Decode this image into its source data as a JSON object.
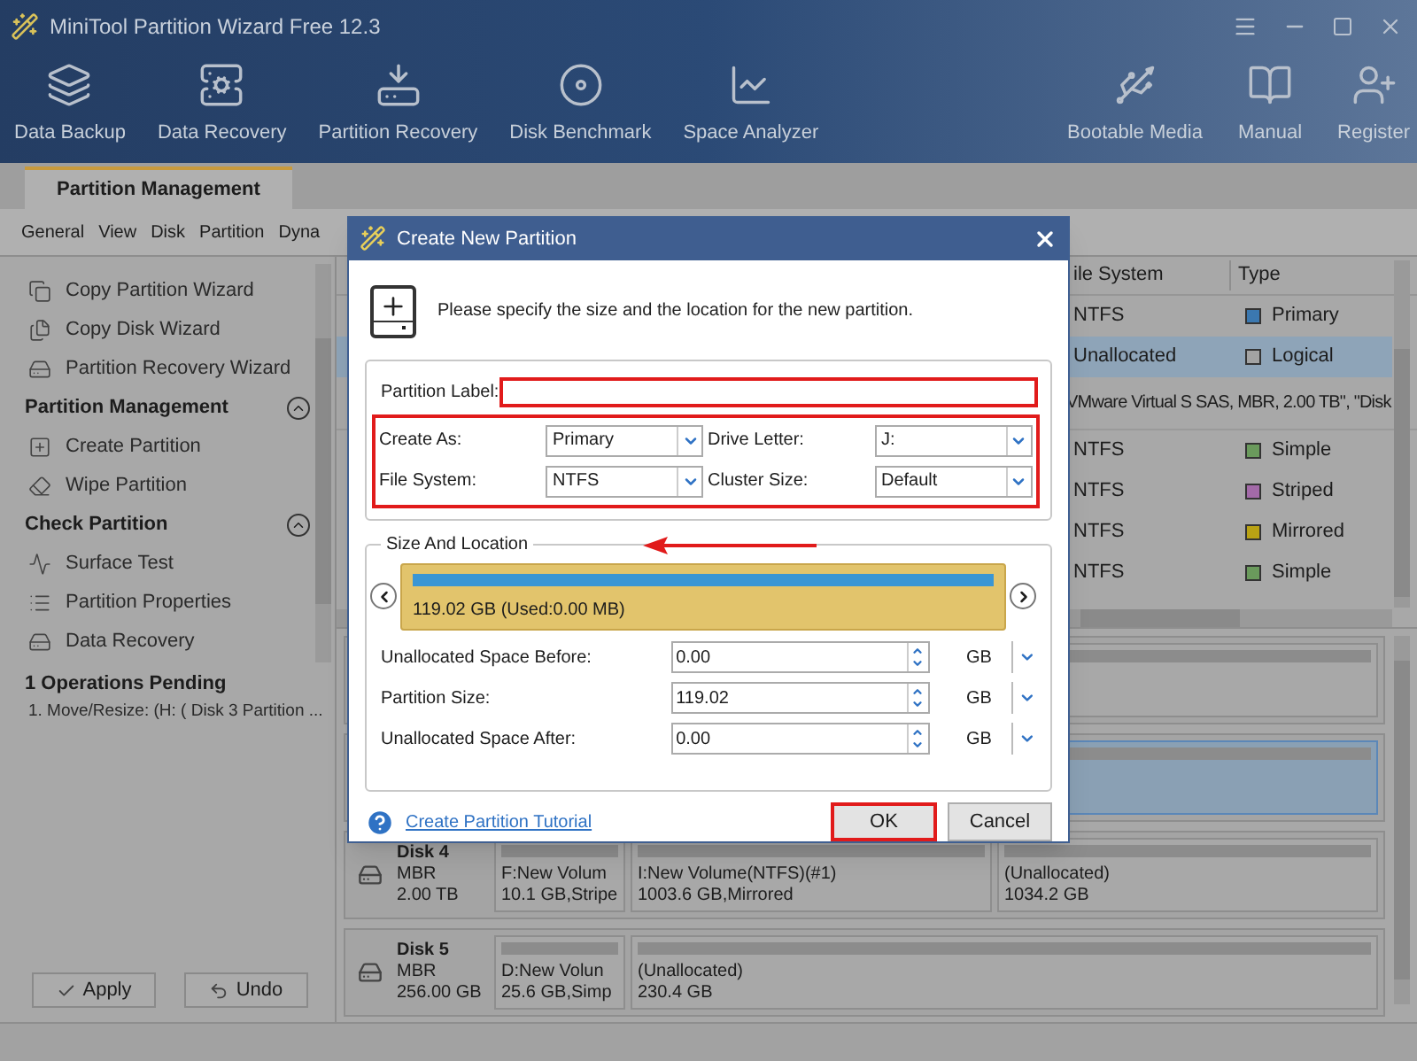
{
  "window": {
    "title": "MiniTool Partition Wizard Free 12.3"
  },
  "toolbar": [
    {
      "label": "Data Backup"
    },
    {
      "label": "Data Recovery"
    },
    {
      "label": "Partition Recovery"
    },
    {
      "label": "Disk Benchmark"
    },
    {
      "label": "Space Analyzer"
    }
  ],
  "toolbar_right": [
    {
      "label": "Bootable Media"
    },
    {
      "label": "Manual"
    },
    {
      "label": "Register"
    }
  ],
  "tabs": [
    {
      "label": "Partition Management",
      "selected": true
    }
  ],
  "menu": [
    "General",
    "View",
    "Disk",
    "Partition",
    "Dyna"
  ],
  "sidebar": {
    "sections": [
      {
        "items": [
          "Copy Partition Wizard",
          "Copy Disk Wizard",
          "Partition Recovery Wizard"
        ]
      },
      {
        "title": "Partition Management",
        "expanded": true,
        "items": [
          "Create Partition",
          "Wipe Partition"
        ]
      },
      {
        "title": "Check Partition",
        "expanded": true,
        "items": [
          "Surface Test",
          "Partition Properties",
          "Data Recovery"
        ]
      }
    ],
    "pending": {
      "title": "1 Operations Pending",
      "items": [
        "1. Move/Resize: (H: ( Disk 3 Partition ..."
      ]
    },
    "buttons": [
      "Apply",
      "Undo"
    ]
  },
  "table": {
    "columns": [
      "ile System",
      "Type"
    ],
    "rows": [
      {
        "kind": "partition",
        "file_system": "NTFS",
        "type": "Primary",
        "color": "#3b78b0",
        "selected": false
      },
      {
        "kind": "partition",
        "file_system": "Unallocated",
        "type": "Logical",
        "color": "#a3a3a3",
        "selected": true
      },
      {
        "kind": "disk",
        "text": "VMware Virtual S SAS, MBR, 2.00 TB\", \"Disk"
      },
      {
        "kind": "partition",
        "file_system": "NTFS",
        "type": "Simple",
        "color": "#6a9a5c",
        "selected": false
      },
      {
        "kind": "partition",
        "file_system": "NTFS",
        "type": "Striped",
        "color": "#a36aa8",
        "selected": false
      },
      {
        "kind": "partition",
        "file_system": "NTFS",
        "type": "Mirrored",
        "color": "#b9a214",
        "selected": false
      },
      {
        "kind": "partition",
        "file_system": "NTFS",
        "type": "Simple",
        "color": "#6a9a5c",
        "selected": false
      }
    ]
  },
  "disk_map": [
    {
      "partitions": [
        {
          "selected": false
        }
      ]
    },
    {
      "partitions": [
        {
          "selected": true
        }
      ]
    },
    {
      "name": "Disk 4",
      "lines": [
        "MBR",
        "2.00 TB"
      ],
      "partitions": [
        {
          "lines": [
            "F:New Volum",
            "10.1 GB,Stripe"
          ],
          "selected": false
        },
        {
          "lines": [
            "I:New Volume(NTFS)(#1)",
            "1003.6 GB,Mirrored"
          ],
          "selected": false
        },
        {
          "lines": [
            "(Unallocated)",
            "1034.2 GB"
          ],
          "selected": false
        }
      ]
    },
    {
      "name": "Disk 5",
      "lines": [
        "MBR",
        "256.00 GB"
      ],
      "partitions": [
        {
          "lines": [
            "D:New Volun",
            "25.6 GB,Simp"
          ],
          "selected": false
        },
        {
          "lines": [
            "(Unallocated)",
            "230.4 GB"
          ],
          "selected": false
        }
      ]
    }
  ],
  "dialog": {
    "title": "Create New Partition",
    "message": "Please specify the size and the location for the new partition.",
    "label_field": {
      "label": "Partition Label:",
      "highlighted": true
    },
    "selects_highlighted": true,
    "selects": [
      {
        "label": "Create As:",
        "value": "Primary"
      },
      {
        "label": "Drive Letter:",
        "value": "J:"
      },
      {
        "label": "File System:",
        "value": "NTFS"
      },
      {
        "label": "Cluster Size:",
        "value": "Default"
      }
    ],
    "size_group": {
      "title": "Size And Location",
      "bar_text": "119.02 GB (Used:0.00 MB)",
      "fields": [
        {
          "label": "Unallocated Space Before:",
          "value": "0.00",
          "unit": "GB"
        },
        {
          "label": "Partition Size:",
          "value": "119.02",
          "unit": "GB"
        },
        {
          "label": "Unallocated Space After:",
          "value": "0.00",
          "unit": "GB"
        }
      ]
    },
    "help_link": "Create Partition Tutorial",
    "buttons": [
      {
        "label": "OK",
        "highlighted": true
      },
      {
        "label": "Cancel",
        "highlighted": false
      }
    ]
  }
}
